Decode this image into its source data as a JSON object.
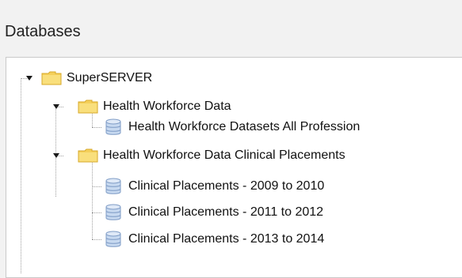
{
  "panel": {
    "title": "Databases"
  },
  "tree": {
    "root": {
      "label": "SuperSERVER",
      "icon": "folder-icon",
      "expanded": true
    },
    "groups": [
      {
        "label": "Health Workforce Data",
        "icon": "folder-icon",
        "expanded": true,
        "items": [
          {
            "label": "Health Workforce Datasets All Profession",
            "icon": "database-icon"
          }
        ]
      },
      {
        "label": "Health Workforce Data Clinical Placements",
        "icon": "folder-icon",
        "expanded": true,
        "items": [
          {
            "label": "Clinical Placements - 2009 to 2010",
            "icon": "database-icon"
          },
          {
            "label": "Clinical Placements - 2011 to 2012",
            "icon": "database-icon"
          },
          {
            "label": "Clinical Placements - 2013 to 2014",
            "icon": "database-icon"
          }
        ]
      }
    ]
  },
  "colors": {
    "background": "#f2f2f2",
    "tree_background": "#ffffff",
    "folder": "#f4cf5a",
    "database": "#a9c3e6"
  }
}
